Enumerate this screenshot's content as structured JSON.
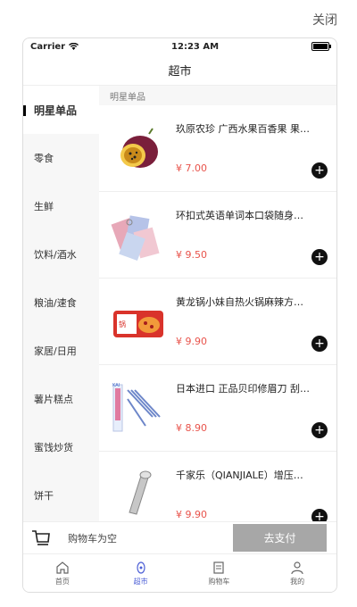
{
  "top": {
    "close_label": "关闭"
  },
  "status": {
    "carrier": "Carrier",
    "time": "12:23 AM"
  },
  "navbar": {
    "title": "超市"
  },
  "sidebar": {
    "items": [
      {
        "label": "明星单品"
      },
      {
        "label": "零食"
      },
      {
        "label": "生鲜"
      },
      {
        "label": "饮料/酒水"
      },
      {
        "label": "粮油/速食"
      },
      {
        "label": "家居/日用"
      },
      {
        "label": "薯片糕点"
      },
      {
        "label": "蜜饯炒货"
      },
      {
        "label": "饼干"
      }
    ]
  },
  "main": {
    "section_title": "明星单品",
    "products": [
      {
        "name": "玖原农珍 广西水果百香果 果…",
        "price": "¥ 7.00",
        "icon": "passion-fruit"
      },
      {
        "name": "环扣式英语单词本口袋随身…",
        "price": "¥ 9.50",
        "icon": "vocabulary-cards"
      },
      {
        "name": "黄龙锅小妹自热火锅麻辣方…",
        "price": "¥ 9.90",
        "icon": "hotpot-box"
      },
      {
        "name": "日本进口 正品贝印修眉刀 刮…",
        "price": "¥ 8.90",
        "icon": "razor-pack"
      },
      {
        "name": "千家乐（QIANJIALE）增压…",
        "price": "¥ 9.90",
        "icon": "shower-head"
      }
    ]
  },
  "cart": {
    "empty_text": "购物车为空",
    "pay_label": "去支付"
  },
  "tabbar": {
    "tabs": [
      {
        "label": "首页"
      },
      {
        "label": "超市"
      },
      {
        "label": "购物车"
      },
      {
        "label": "我的"
      }
    ]
  },
  "colors": {
    "accent": "#4c5fd6",
    "price": "#e8534b",
    "pay_button": "#a7a7a7"
  }
}
